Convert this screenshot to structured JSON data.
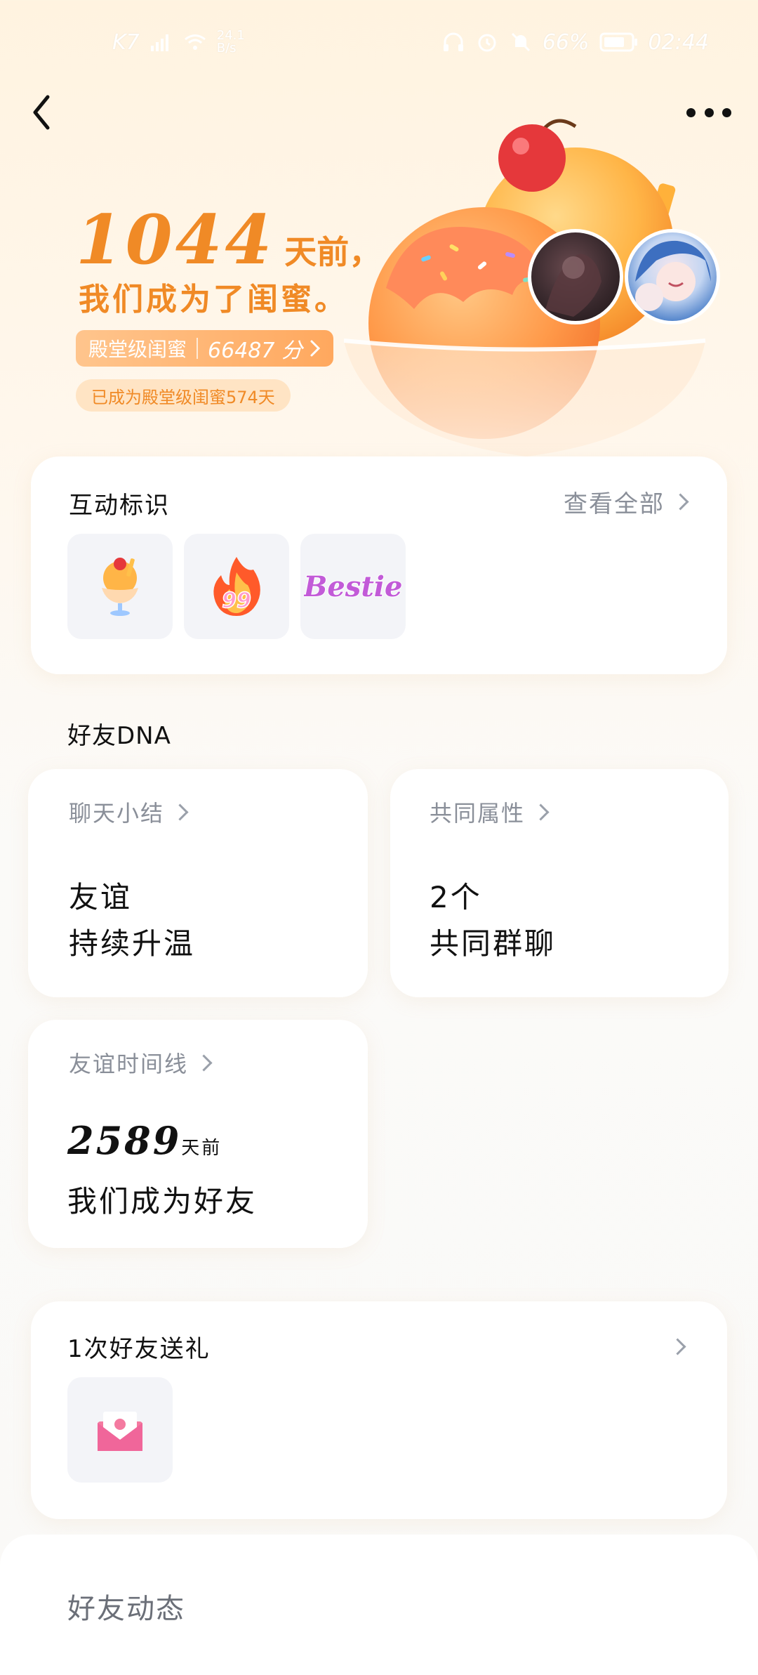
{
  "status_bar": {
    "left_text": "K7",
    "speed_value": "24.1",
    "speed_unit": "B/s",
    "battery": "66%",
    "time": "02:44"
  },
  "hero": {
    "days_number": "1044",
    "days_suffix": "天前，",
    "line2": "我们成为了闺蜜。",
    "level_label": "殿堂级闺蜜",
    "score": "66487 分",
    "duration": "已成为殿堂级闺蜜574天"
  },
  "interaction_card": {
    "title": "互动标识",
    "view_all": "查看全部",
    "badges": [
      "ice-cream-badge",
      "fire-99-badge",
      "bestie-badge"
    ],
    "bestie_text": "Bestie",
    "fire_number": "99"
  },
  "dna": {
    "section_title": "好友DNA",
    "chat_summary": {
      "title": "聊天小结",
      "line1": "友谊",
      "line2": "持续升温"
    },
    "common_attrs": {
      "title": "共同属性",
      "line1": "2个",
      "line2": "共同群聊"
    },
    "timeline": {
      "title": "友谊时间线",
      "number": "2589",
      "unit": "天前",
      "line2": "我们成为好友"
    }
  },
  "gift_card": {
    "title": "1次好友送礼",
    "gift_icon": "envelope-gift-icon"
  },
  "feed": {
    "title": "好友动态"
  },
  "colors": {
    "accent_orange": "#f08a26",
    "pill_orange": "#ffa85e",
    "card_bg": "#ffffff",
    "tile_bg": "#f3f4f8"
  }
}
